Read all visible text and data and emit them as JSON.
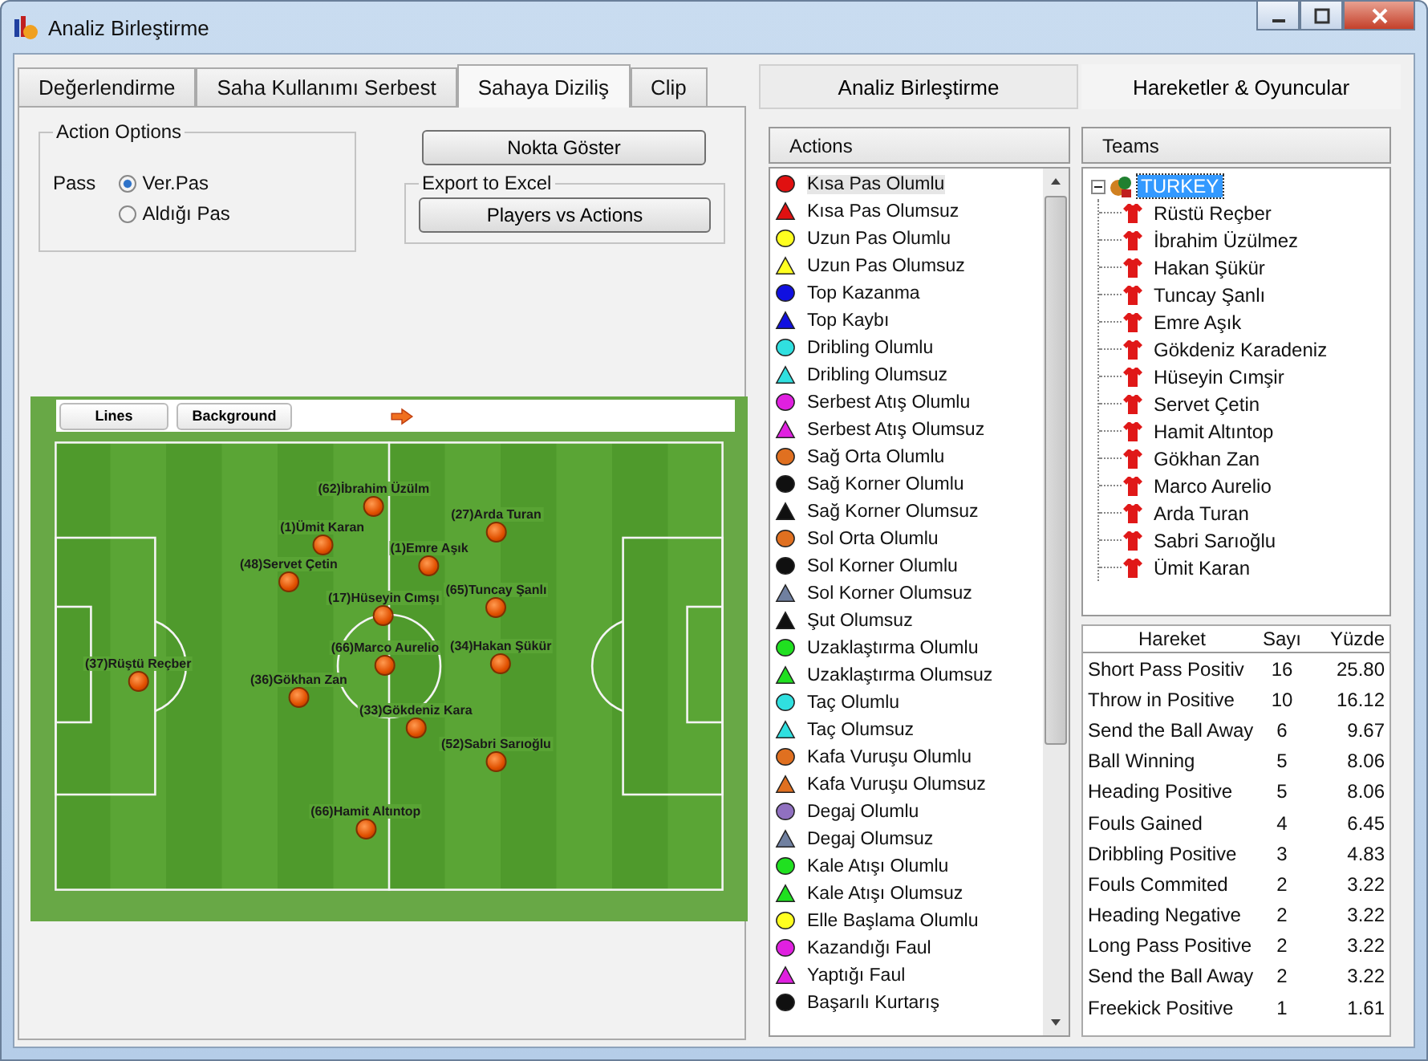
{
  "window": {
    "title": "Analiz Birleştirme"
  },
  "left_tabs": [
    {
      "label": "Değerlendirme",
      "selected": false
    },
    {
      "label": "Saha Kullanımı Serbest",
      "selected": false
    },
    {
      "label": "Sahaya Diziliş",
      "selected": true
    },
    {
      "label": "Clip",
      "selected": false
    }
  ],
  "action_options": {
    "title": "Action Options",
    "pass_label": "Pass",
    "options": [
      {
        "label": "Ver.Pas",
        "selected": true
      },
      {
        "label": "Aldığı Pas",
        "selected": false
      }
    ]
  },
  "nokta_button": "Nokta Göster",
  "export": {
    "title": "Export to Excel",
    "button": "Players vs Actions"
  },
  "pitch_toolbar": [
    "Lines",
    "Background"
  ],
  "players_on_pitch": [
    "(62)İbrahim Üzülm",
    "(1)Ümit Karan",
    "(1)Emre Aşık",
    "(27)Arda Turan",
    "(48)Servet Çetin",
    "(65)Tuncay Şanlı",
    "(17)Hüseyin Cımşı",
    "(66)Marco Aurelio",
    "(34)Hakan Şükür",
    "(37)Rüştü Reçber",
    "(36)Gökhan Zan",
    "(33)Gökdeniz Kara",
    "(52)Sabri Sarıoğlu",
    "(66)Hamit Altıntop"
  ],
  "right_tabs": [
    {
      "label": "Analiz Birleştirme",
      "selected": false
    },
    {
      "label": "Hareketler & Oyuncular",
      "selected": true
    }
  ],
  "actions": {
    "header": "Actions",
    "items": [
      {
        "label": "Kısa Pas Olumlu",
        "kind": "circle",
        "color": "#e01010",
        "selected": true
      },
      {
        "label": "Kısa Pas Olumsuz",
        "kind": "triangle",
        "color": "#e01010",
        "selected": false
      },
      {
        "label": "Uzun Pas Olumlu",
        "kind": "circle",
        "color": "#ffff20",
        "selected": false
      },
      {
        "label": "Uzun Pas Olumsuz",
        "kind": "triangle",
        "color": "#ffff20",
        "selected": false
      },
      {
        "label": "Top Kazanma",
        "kind": "circle",
        "color": "#1010e0",
        "selected": false
      },
      {
        "label": "Top Kaybı",
        "kind": "triangle",
        "color": "#1010e0",
        "selected": false
      },
      {
        "label": "Dribling Olumlu",
        "kind": "circle",
        "color": "#30e0e0",
        "selected": false
      },
      {
        "label": "Dribling Olumsuz",
        "kind": "triangle",
        "color": "#30e0e0",
        "selected": false
      },
      {
        "label": "Serbest Atış Olumlu",
        "kind": "circle",
        "color": "#e020e0",
        "selected": false
      },
      {
        "label": "Serbest Atış Olumsuz",
        "kind": "triangle",
        "color": "#e020e0",
        "selected": false
      },
      {
        "label": "Sağ Orta Olumlu",
        "kind": "circle",
        "color": "#e07020",
        "selected": false
      },
      {
        "label": "Sağ Korner Olumlu",
        "kind": "circle",
        "color": "#101010",
        "selected": false
      },
      {
        "label": "Sağ Korner Olumsuz",
        "kind": "triangle",
        "color": "#101010",
        "selected": false
      },
      {
        "label": "Sol Orta Olumlu",
        "kind": "circle",
        "color": "#e07020",
        "selected": false
      },
      {
        "label": "Sol Korner Olumlu",
        "kind": "circle",
        "color": "#101010",
        "selected": false
      },
      {
        "label": "Sol Korner Olumsuz",
        "kind": "triangle",
        "color": "#7080a0",
        "selected": false
      },
      {
        "label": "Şut Olumsuz",
        "kind": "triangle",
        "color": "#101010",
        "selected": false
      },
      {
        "label": "Uzaklaştırma Olumlu",
        "kind": "circle",
        "color": "#20e020",
        "selected": false
      },
      {
        "label": "Uzaklaştırma Olumsuz",
        "kind": "triangle",
        "color": "#20e020",
        "selected": false
      },
      {
        "label": "Taç Olumlu",
        "kind": "circle",
        "color": "#30e0e0",
        "selected": false
      },
      {
        "label": "Taç Olumsuz",
        "kind": "triangle",
        "color": "#30e0e0",
        "selected": false
      },
      {
        "label": "Kafa Vuruşu Olumlu",
        "kind": "circle",
        "color": "#e07020",
        "selected": false
      },
      {
        "label": "Kafa Vuruşu Olumsuz",
        "kind": "triangle",
        "color": "#e07020",
        "selected": false
      },
      {
        "label": "Degaj Olumlu",
        "kind": "circle",
        "color": "#9070c0",
        "selected": false
      },
      {
        "label": "Degaj Olumsuz",
        "kind": "triangle",
        "color": "#7080a0",
        "selected": false
      },
      {
        "label": "Kale Atışı Olumlu",
        "kind": "circle",
        "color": "#20e020",
        "selected": false
      },
      {
        "label": "Kale Atışı Olumsuz",
        "kind": "triangle",
        "color": "#20e020",
        "selected": false
      },
      {
        "label": "Elle Başlama Olumlu",
        "kind": "circle",
        "color": "#ffff20",
        "selected": false
      },
      {
        "label": "Kazandığı Faul",
        "kind": "circle",
        "color": "#e020e0",
        "selected": false
      },
      {
        "label": "Yaptığı Faul",
        "kind": "triangle",
        "color": "#e020e0",
        "selected": false
      },
      {
        "label": "Başarılı Kurtarış",
        "kind": "circle",
        "color": "#101010",
        "selected": false
      }
    ]
  },
  "teams": {
    "header": "Teams",
    "tree": [
      {
        "label": "TURKEY",
        "expanded": true,
        "selected": true,
        "children": [
          {
            "label": "Rüstü Reçber"
          },
          {
            "label": "İbrahim Üzülmez"
          },
          {
            "label": "Hakan Şükür"
          },
          {
            "label": "Tuncay Şanlı"
          },
          {
            "label": "Emre Aşık"
          },
          {
            "label": "Gökdeniz Karadeniz"
          },
          {
            "label": "Hüseyin Cımşir"
          },
          {
            "label": "Servet Çetin"
          },
          {
            "label": "Hamit Altıntop"
          },
          {
            "label": "Gökhan Zan"
          },
          {
            "label": "Marco Aurelio"
          },
          {
            "label": "Arda Turan"
          },
          {
            "label": "Sabri Sarıoğlu"
          },
          {
            "label": "Ümit Karan"
          }
        ]
      }
    ]
  },
  "table": {
    "columns": [
      "Hareket",
      "Sayı",
      "Yüzde"
    ],
    "rows": [
      [
        "Short Pass Positiv",
        "16",
        "25.80"
      ],
      [
        "Throw in Positive",
        "10",
        "16.12"
      ],
      [
        "Send the Ball Away",
        "6",
        "9.67"
      ],
      [
        "Ball Winning",
        "5",
        "8.06"
      ],
      [
        "Heading Positive",
        "5",
        "8.06"
      ],
      [
        "Fouls Gained",
        "4",
        "6.45"
      ],
      [
        "Dribbling Positive",
        "3",
        "4.83"
      ],
      [
        "Fouls Commited",
        "2",
        "3.22"
      ],
      [
        "Heading Negative",
        "2",
        "3.22"
      ],
      [
        "Long Pass Positive",
        "2",
        "3.22"
      ],
      [
        "Send the Ball Away",
        "2",
        "3.22"
      ],
      [
        "Freekick Positive",
        "1",
        "1.61"
      ]
    ]
  }
}
